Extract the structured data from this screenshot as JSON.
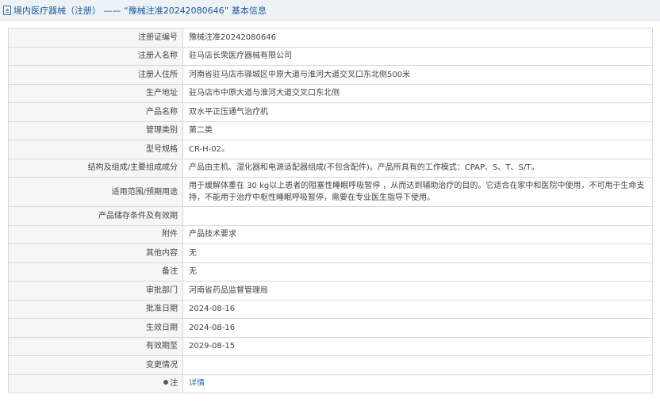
{
  "header": {
    "breadcrumb": "境内医疗器械（注册） —— “豫械注准20242080646” 基本信息"
  },
  "rows": [
    {
      "label": "注册证编号",
      "value": "豫械注准20242080646"
    },
    {
      "label": "注册人名称",
      "value": "驻马店长荣医疗器械有限公司"
    },
    {
      "label": "注册人住所",
      "value": "河南省驻马店市驿城区中原大道与淮河大道交叉口东北侧500米"
    },
    {
      "label": "生产地址",
      "value": "驻马店市中原大道与淮河大道交叉口东北侧"
    },
    {
      "label": "产品名称",
      "value": "双水平正压通气治疗机"
    },
    {
      "label": "管理类别",
      "value": "第二类"
    },
    {
      "label": "型号规格",
      "value": "CR-H-02。"
    },
    {
      "label": "结构及组成/主要组成成分",
      "value": "产品由主机、湿化器和电源适配器组成(不包含配件)。产品所具有的工作模式：CPAP、S、T、S/T。"
    },
    {
      "label": "适用范围/预期用途",
      "value": "用于缓解体重在 30 kg以上患者的阻塞性睡眠呼吸暂停 ，从而达到辅助治疗的目的。它适合在家中和医院中使用，不可用于生命支持，不能用于治疗中枢性睡眠呼吸暂停，需要在专业医生指导下使用。"
    },
    {
      "label": "产品储存条件及有效期",
      "value": ""
    },
    {
      "label": "附件",
      "value": "产品技术要求"
    },
    {
      "label": "其他内容",
      "value": "无"
    },
    {
      "label": "备注",
      "value": "无"
    },
    {
      "label": "审批部门",
      "value": "河南省药品监督管理局"
    },
    {
      "label": "批准日期",
      "value": "2024-08-16"
    },
    {
      "label": "生效日期",
      "value": "2024-08-16"
    },
    {
      "label": "有效期至",
      "value": "2029-08-15"
    },
    {
      "label": "变更情况",
      "value": ""
    }
  ],
  "note_row": {
    "label": "注",
    "value": "详情",
    "icon": "pin-icon"
  }
}
